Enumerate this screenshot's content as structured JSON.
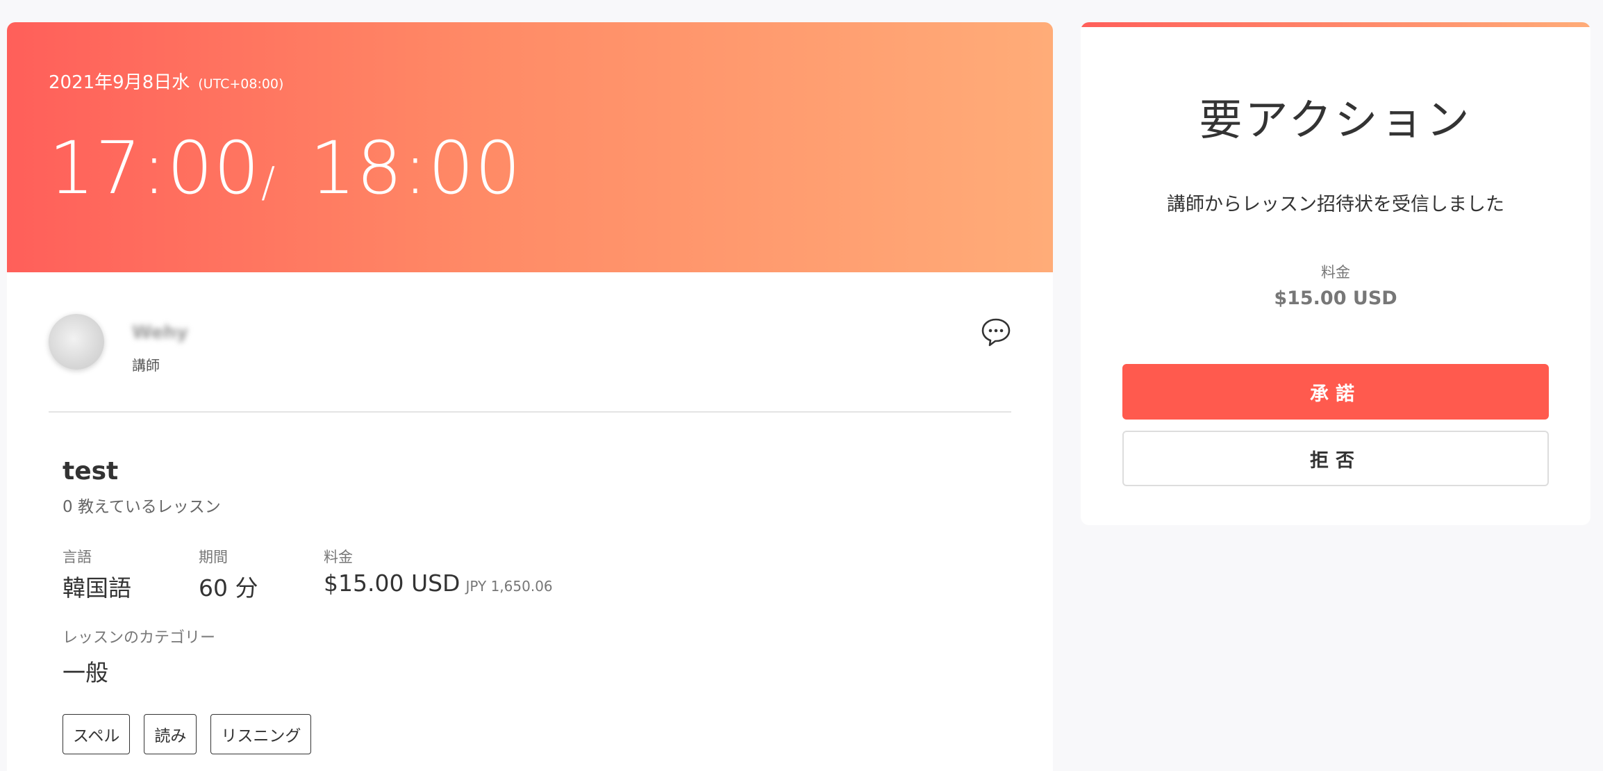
{
  "lesson_header": {
    "date": "2021年9月8日水",
    "timezone": "(UTC+08:00)",
    "start_time": "17:00",
    "separator": "/",
    "end_time": "18:00"
  },
  "teacher": {
    "name": "Wehy",
    "role": "講師",
    "chat_icon": "chat-bubble-icon"
  },
  "lesson": {
    "title": "test",
    "subtitle": "0 教えているレッスン",
    "language_label": "言語",
    "language_value": "韓国語",
    "duration_label": "期間",
    "duration_value": "60 分",
    "price_label": "料金",
    "price_value": "$15.00 USD",
    "price_converted": "JPY 1,650.06",
    "category_label": "レッスンのカテゴリー",
    "category_value": "一般",
    "tags": [
      "スペル",
      "読み",
      "リスニング"
    ]
  },
  "action_panel": {
    "title": "要アクション",
    "message": "講師からレッスン招待状を受信しました",
    "fee_label": "料金",
    "fee_value": "$15.00 USD",
    "accept_label": "承諾",
    "decline_label": "拒否"
  },
  "colors": {
    "gradient_start": "#ff5f5a",
    "gradient_end": "#ffac78",
    "accept_button": "#ff5a4e"
  }
}
